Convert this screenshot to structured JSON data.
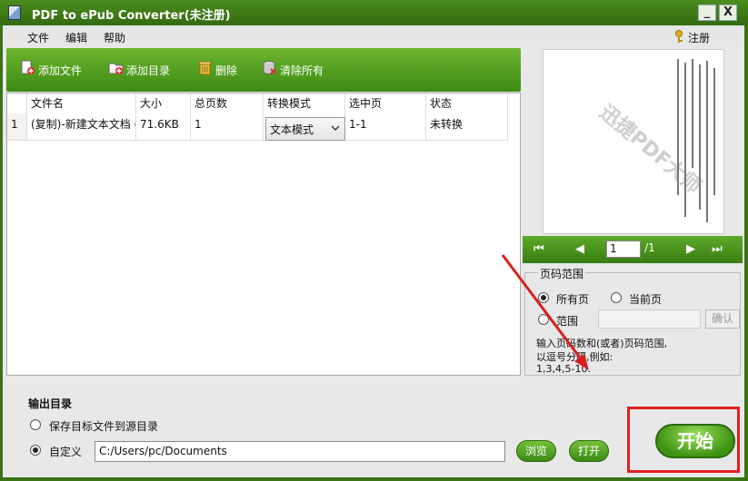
{
  "window": {
    "title": "PDF to ePub Converter(未注册)",
    "min_label": "_",
    "close_label": "X"
  },
  "menu": {
    "items": [
      "文件",
      "编辑",
      "帮助"
    ],
    "register": "注册"
  },
  "toolbar": {
    "add_file": "添加文件",
    "add_folder": "添加目录",
    "delete": "删除",
    "clear_all": "清除所有"
  },
  "table": {
    "headers": [
      "文件名",
      "大小",
      "总页数",
      "转换模式",
      "选中页",
      "状态"
    ],
    "rows": [
      {
        "num": "1",
        "name": "(复制)-新建文本文档 (",
        "size": "71.6KB",
        "pages": "1",
        "mode": "文本模式",
        "selected": "1-1",
        "status": "未转换"
      }
    ]
  },
  "preview": {
    "watermark": "迅捷PDF大师",
    "page": "1",
    "total": "/1",
    "first": "⏮",
    "prev": "◀",
    "next": "▶",
    "last": "⏭"
  },
  "range": {
    "legend": "页码范围",
    "all": "所有页",
    "current": "当前页",
    "custom": "范围",
    "confirm": "确认",
    "hint1": "输入页码数和(或者)页码范围,",
    "hint2": "以逗号分隔,例如:",
    "hint3": "1,3,4,5-10."
  },
  "output": {
    "title": "输出目录",
    "source": "保存目标文件到源目录",
    "custom": "自定义",
    "path": "C:/Users/pc/Documents",
    "browse": "浏览",
    "open": "打开",
    "start": "开始"
  },
  "colors": {
    "accent": "#3a8a12",
    "highlight": "#e02020"
  }
}
